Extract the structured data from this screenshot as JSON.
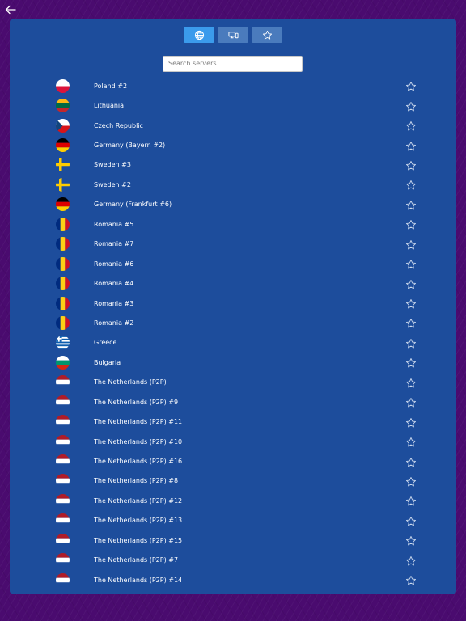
{
  "nav": {
    "back_icon": "arrow-left-icon"
  },
  "tabs": [
    {
      "id": "all",
      "icon": "globe-icon",
      "active": true
    },
    {
      "id": "devices",
      "icon": "devices-icon",
      "active": false
    },
    {
      "id": "favorites",
      "icon": "star-icon",
      "active": false
    }
  ],
  "search": {
    "placeholder": "Search servers...",
    "value": ""
  },
  "colors": {
    "panel": "#1d4d9c",
    "tab_active": "#3b9bec",
    "tab_inactive": "#4a7bbd",
    "background": "#4a0b6f"
  },
  "servers": [
    {
      "name": "Poland #2",
      "flag": "poland-flag-icon"
    },
    {
      "name": "Lithuania",
      "flag": "lithuania-flag-icon"
    },
    {
      "name": "Czech Republic",
      "flag": "czech-republic-flag-icon"
    },
    {
      "name": "Germany (Bayern #2)",
      "flag": "germany-flag-icon"
    },
    {
      "name": "Sweden #3",
      "flag": "sweden-flag-icon"
    },
    {
      "name": "Sweden #2",
      "flag": "sweden-flag-icon"
    },
    {
      "name": "Germany (Frankfurt #6)",
      "flag": "germany-flag-icon"
    },
    {
      "name": "Romania #5",
      "flag": "romania-flag-icon"
    },
    {
      "name": "Romania #7",
      "flag": "romania-flag-icon"
    },
    {
      "name": "Romania #6",
      "flag": "romania-flag-icon"
    },
    {
      "name": "Romania #4",
      "flag": "romania-flag-icon"
    },
    {
      "name": "Romania #3",
      "flag": "romania-flag-icon"
    },
    {
      "name": "Romania #2",
      "flag": "romania-flag-icon"
    },
    {
      "name": "Greece",
      "flag": "greece-flag-icon"
    },
    {
      "name": "Bulgaria",
      "flag": "bulgaria-flag-icon"
    },
    {
      "name": "The Netherlands (P2P)",
      "flag": "netherlands-flag-icon"
    },
    {
      "name": "The Netherlands (P2P) #9",
      "flag": "netherlands-flag-icon"
    },
    {
      "name": "The Netherlands (P2P) #11",
      "flag": "netherlands-flag-icon"
    },
    {
      "name": "The Netherlands (P2P) #10",
      "flag": "netherlands-flag-icon"
    },
    {
      "name": "The Netherlands (P2P) #16",
      "flag": "netherlands-flag-icon"
    },
    {
      "name": "The Netherlands (P2P) #8",
      "flag": "netherlands-flag-icon"
    },
    {
      "name": "The Netherlands (P2P) #12",
      "flag": "netherlands-flag-icon"
    },
    {
      "name": "The Netherlands (P2P) #13",
      "flag": "netherlands-flag-icon"
    },
    {
      "name": "The Netherlands (P2P) #15",
      "flag": "netherlands-flag-icon"
    },
    {
      "name": "The Netherlands (P2P) #7",
      "flag": "netherlands-flag-icon"
    },
    {
      "name": "The Netherlands (P2P) #14",
      "flag": "netherlands-flag-icon"
    }
  ]
}
